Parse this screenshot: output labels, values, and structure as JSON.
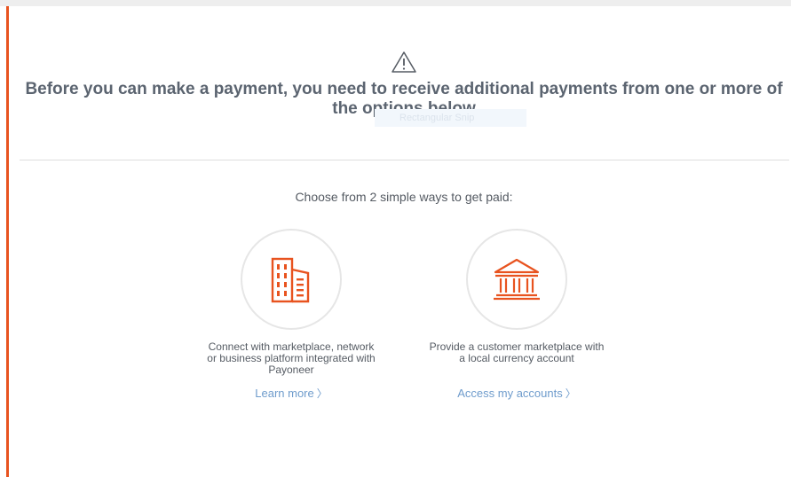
{
  "colors": {
    "accent": "#e8531f",
    "text": "#5b6470",
    "link": "#6f9ccc"
  },
  "header": {
    "icon": "warning-triangle-icon",
    "title": "Before you can make a payment, you need to receive additional payments from one or more of the options below",
    "overlay_text": "Rectangular Snip"
  },
  "main": {
    "intro": "Choose from 2 simple ways to get paid:",
    "options": [
      {
        "icon": "office-building-icon",
        "description": "Connect with marketplace, network or business platform integrated with Payoneer",
        "link_label": "Learn more",
        "link_chevron": "〉"
      },
      {
        "icon": "bank-icon",
        "description": "Provide a customer marketplace with a local currency account",
        "link_label": "Access my accounts",
        "link_chevron": "〉"
      }
    ]
  }
}
